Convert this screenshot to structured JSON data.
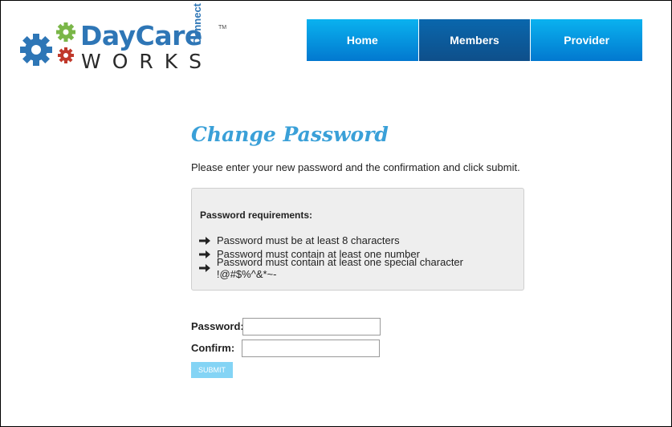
{
  "brand": {
    "line1": "DayCare",
    "line2": "WORKS",
    "side": "Connect",
    "tm": "TM",
    "colors": {
      "blue": "#2e76b6",
      "green": "#7ab648",
      "red": "#c0392b"
    }
  },
  "nav": {
    "items": [
      {
        "label": "Home",
        "active": false
      },
      {
        "label": "Members",
        "active": true
      },
      {
        "label": "Provider",
        "active": false
      }
    ]
  },
  "page": {
    "title": "Change Password",
    "intro": "Please enter your new password and the confirmation and click submit."
  },
  "requirements": {
    "title": "Password requirements:",
    "icon": "arrow-right-icon",
    "items": [
      "Password must be at least 8 characters",
      "Password must contain at least one number",
      "Password must contain at least one special character !@#$%^&*~-"
    ]
  },
  "form": {
    "password_label": "Password:",
    "password_value": "",
    "confirm_label": "Confirm:",
    "confirm_value": "",
    "submit_label": "SUBMIT"
  }
}
